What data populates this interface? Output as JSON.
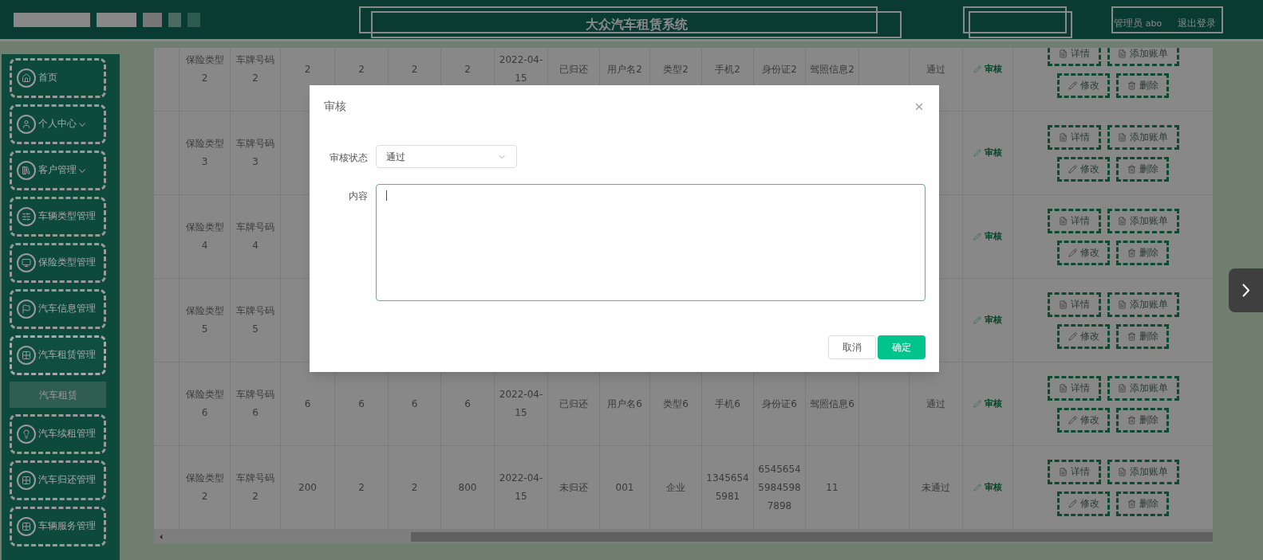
{
  "header": {
    "title": "大众汽车租赁系统",
    "role": "管理员",
    "username": "abo",
    "logout": "退出登录"
  },
  "sidebar": {
    "items": [
      {
        "label": "首页",
        "expandable": false,
        "expanded": false
      },
      {
        "label": "个人中心",
        "expandable": true,
        "expanded": false
      },
      {
        "label": "客户管理",
        "expandable": true,
        "expanded": false
      },
      {
        "label": "车辆类型管理",
        "expandable": false,
        "expanded": false
      },
      {
        "label": "保险类型管理",
        "expandable": false,
        "expanded": false
      },
      {
        "label": "汽车信息管理",
        "expandable": false,
        "expanded": false
      },
      {
        "label": "汽车租赁管理",
        "expandable": false,
        "expanded": true,
        "children": [
          {
            "label": "汽车租赁"
          }
        ]
      },
      {
        "label": "汽车续租管理",
        "expandable": false,
        "expanded": false
      },
      {
        "label": "汽车归还管理",
        "expandable": false,
        "expanded": false
      },
      {
        "label": "车辆服务管理",
        "expandable": false,
        "expanded": false
      }
    ]
  },
  "table": {
    "rows": [
      {
        "column_1": "保险类型2",
        "column_2": "车牌号码2",
        "column_3": "2",
        "column_4": "2",
        "column_5": "2",
        "column_6": "2",
        "column_7": "2022-04-15",
        "column_8": "已归还",
        "column_9": "用户名2",
        "column_10": "类型2",
        "column_11": "手机2",
        "column_12": "身份证2",
        "column_13": "驾照信息2",
        "column_15": "通过",
        "review": "审核",
        "actions": [
          "详情",
          "添加账单",
          "修改",
          "删除"
        ]
      },
      {
        "column_1": "保险类型3",
        "column_2": "车牌号码3",
        "review": "审核",
        "actions": [
          "详情",
          "添加账单",
          "修改",
          "删除"
        ]
      },
      {
        "column_1": "保险类型4",
        "column_2": "车牌号码4",
        "review": "审核",
        "actions": [
          "详情",
          "添加账单",
          "修改",
          "删除"
        ]
      },
      {
        "column_1": "保险类型5",
        "column_2": "车牌号码5",
        "review": "审核",
        "actions": [
          "详情",
          "添加账单",
          "修改",
          "删除"
        ]
      },
      {
        "column_1": "保险类型6",
        "column_2": "车牌号码6",
        "column_3": "6",
        "column_4": "6",
        "column_5": "6",
        "column_6": "6",
        "column_7": "2022-04-15",
        "column_8": "已归还",
        "column_9": "用户名6",
        "column_10": "类型6",
        "column_11": "手机6",
        "column_12": "身份证6",
        "column_13": "驾照信息6",
        "column_15": "通过",
        "review": "审核",
        "actions": [
          "详情",
          "添加账单",
          "修改",
          "删除"
        ]
      },
      {
        "column_1": "保险类型2",
        "column_2": "车牌号码2",
        "column_3": "200",
        "column_4": "2",
        "column_5": "2",
        "column_6": "800",
        "column_7": "2022-04-15",
        "column_8": "未归还",
        "column_9": "001",
        "column_10": "企业",
        "column_11": "13456545981",
        "column_12": "654565459845987898",
        "column_13": "11",
        "column_15": "未通过",
        "review": "审核",
        "actions": [
          "详情",
          "添加账单",
          "修改",
          "删除"
        ]
      }
    ]
  },
  "dialog": {
    "title": "审核",
    "fields": [
      {
        "label": "审核状态",
        "kind": "select",
        "value": "通过"
      },
      {
        "label": "内容",
        "kind": "textarea",
        "focused": true
      }
    ],
    "buttons": [
      {
        "label": "取消",
        "kind": "secondary"
      },
      {
        "label": "确定",
        "kind": "primary"
      }
    ]
  }
}
